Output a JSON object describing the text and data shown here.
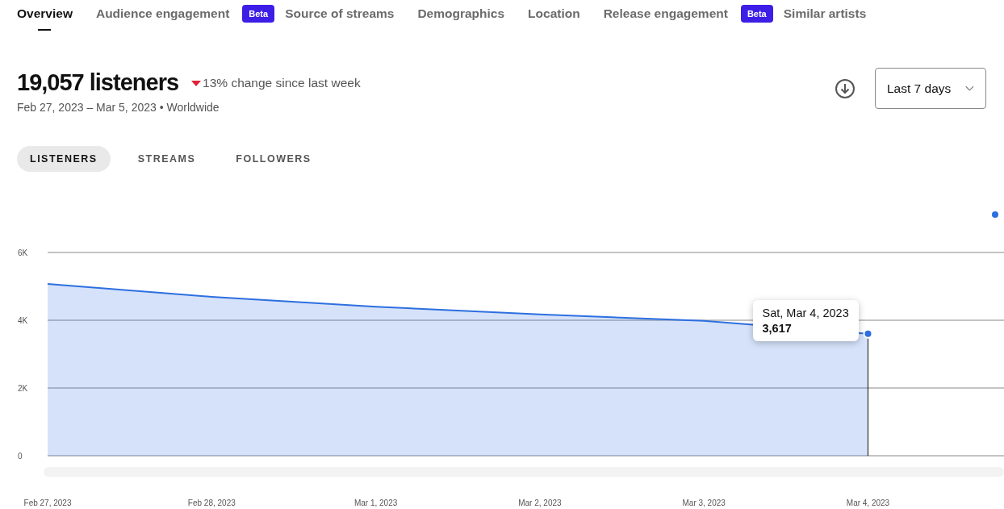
{
  "nav_tabs": [
    {
      "label": "Overview",
      "selected": true
    },
    {
      "label": "Audience engagement",
      "selected": false,
      "badge": "Beta"
    },
    {
      "label": "Source of streams",
      "selected": false
    },
    {
      "label": "Demographics",
      "selected": false
    },
    {
      "label": "Location",
      "selected": false
    },
    {
      "label": "Release engagement",
      "selected": false,
      "badge": "Beta"
    },
    {
      "label": "Similar artists",
      "selected": false
    }
  ],
  "summary": {
    "total": "19,057 listeners",
    "decrease": true,
    "change": "13% change since last week",
    "range": "Feb 27, 2023 – Mar 5, 2023 • Worldwide"
  },
  "period_select": {
    "value": "Last 7 days"
  },
  "metric_tabs": [
    {
      "label": "LISTENERS",
      "selected": true
    },
    {
      "label": "STREAMS",
      "selected": false
    },
    {
      "label": "FOLLOWERS",
      "selected": false
    }
  ],
  "chart": {
    "chart_data": {
      "type": "area",
      "categories": [
        "Feb 27, 2023",
        "Feb 28, 2023",
        "Mar 1, 2023",
        "Mar 2, 2023",
        "Mar 3, 2023",
        "Mar 4, 2023"
      ],
      "series": [
        {
          "color": "#2d6fe0",
          "values": [
            5070,
            4690,
            4400,
            4170,
            3980,
            3600
          ]
        }
      ],
      "ylim": [
        0,
        6000
      ],
      "yticks": [
        {
          "value": 0,
          "label": "0"
        },
        {
          "value": 2000,
          "label": "2K"
        },
        {
          "value": 4000,
          "label": "4K"
        },
        {
          "value": 6000,
          "label": "6K"
        }
      ]
    },
    "tooltip": {
      "date": "Sat, Mar 4, 2023",
      "value": "3,617"
    }
  }
}
